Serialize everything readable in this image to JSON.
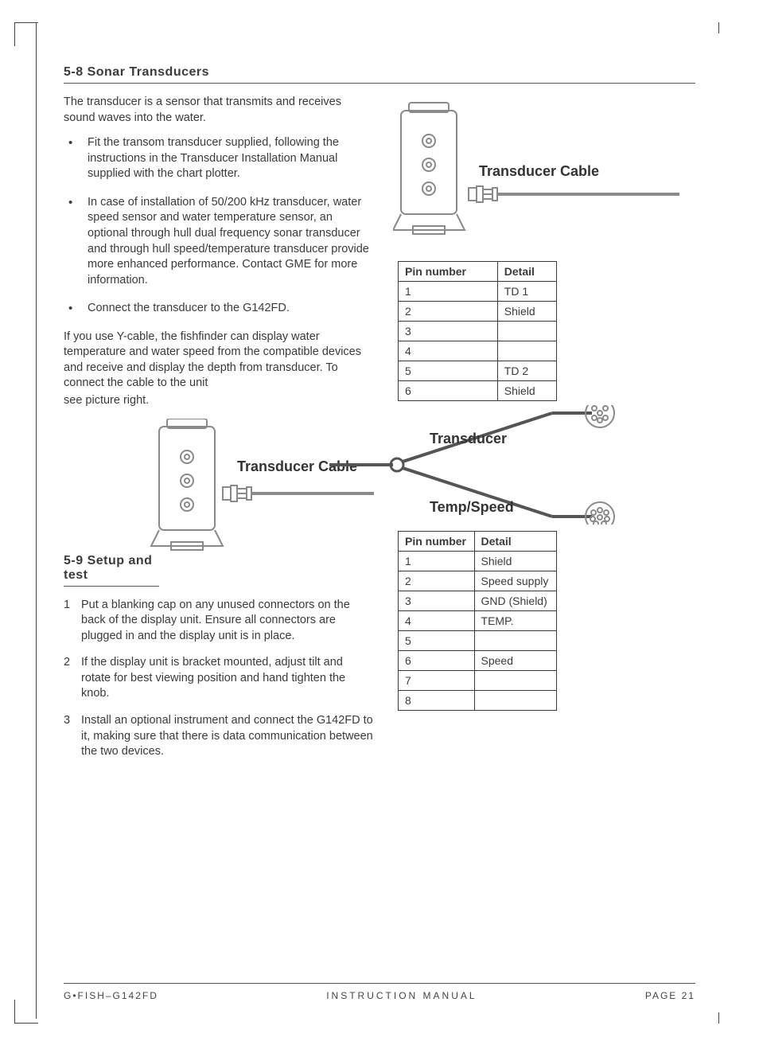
{
  "section58": {
    "title": "5-8 Sonar Transducers",
    "intro": "The transducer is a sensor that transmits and receives sound waves into the water.",
    "bullets": [
      "Fit the transom transducer supplied, following the instructions in the Transducer Installation Manual supplied with the chart plotter.",
      "In case of installation of 50/200 kHz transducer, water speed sensor and water temperature sensor, an optional through hull dual frequency sonar transducer and through hull speed/temperature transducer provide more enhanced performance. Contact GME for more information.",
      "Connect the transducer to the G142FD."
    ],
    "after_bullets_1": "If you use Y-cable, the fishfinder can display water temperature and water speed from the compatible devices and receive and display the depth from transducer. To connect the cable to the unit",
    "after_bullets_2": "see picture right."
  },
  "section59": {
    "title": "5-9 Setup and test",
    "steps": [
      "Put a blanking cap on any unused connectors on the back of the display unit. Ensure all connectors are plugged in and the display unit is in place.",
      "If the display unit is bracket mounted, adjust tilt and rotate for best viewing position and hand tighten the knob.",
      "Install an optional instrument and connect the G142FD to it, making sure that there is data communication between the two devices."
    ]
  },
  "labels": {
    "transducer_cable": "Transducer Cable",
    "transducer": "Transducer",
    "temp_speed": "Temp/Speed"
  },
  "table_transducer": {
    "headers": [
      "Pin number",
      "Detail"
    ],
    "rows": [
      [
        "1",
        "TD 1"
      ],
      [
        "2",
        "Shield"
      ],
      [
        "3",
        ""
      ],
      [
        "4",
        ""
      ],
      [
        "5",
        "TD 2"
      ],
      [
        "6",
        "Shield"
      ]
    ]
  },
  "table_tempspeed": {
    "headers": [
      "Pin number",
      "Detail"
    ],
    "rows": [
      [
        "1",
        "Shield"
      ],
      [
        "2",
        "Speed supply"
      ],
      [
        "3",
        "GND (Shield)"
      ],
      [
        "4",
        "TEMP."
      ],
      [
        "5",
        ""
      ],
      [
        "6",
        "Speed"
      ],
      [
        "7",
        ""
      ],
      [
        "8",
        ""
      ]
    ]
  },
  "footer": {
    "left": "G•FISH–G142FD",
    "mid": "INSTRUCTION MANUAL",
    "right": "PAGE 21"
  }
}
